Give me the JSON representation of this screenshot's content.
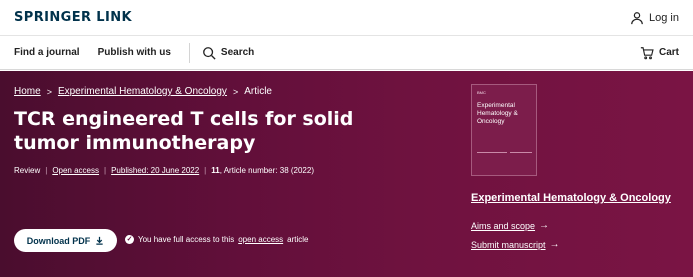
{
  "header": {
    "logo": "SPRINGER LINK",
    "login_label": "Log in"
  },
  "nav": {
    "find_journal": "Find a journal",
    "publish": "Publish with us",
    "search": "Search",
    "cart": "Cart"
  },
  "breadcrumb": {
    "home": "Home",
    "journal": "Experimental Hematology & Oncology",
    "current": "Article"
  },
  "article": {
    "title": "TCR engineered T cells for solid tumor immunotherapy",
    "type": "Review",
    "open_access": "Open access",
    "published": "Published: 20 June 2022",
    "volume": "11",
    "article_number": ", Article number: 38 (2022)"
  },
  "actions": {
    "download_label": "Download PDF",
    "access_prefix": "You have full access to this",
    "access_link": "open access",
    "access_suffix": "article"
  },
  "journal": {
    "cover_publisher": "BMC",
    "cover_title": "Experimental Hematology & Oncology",
    "name": "Experimental Hematology & Oncology",
    "aims_scope": "Aims and scope",
    "submit": "Submit manuscript"
  },
  "colors": {
    "brand": "#01324b",
    "hero": "#6a1040"
  }
}
